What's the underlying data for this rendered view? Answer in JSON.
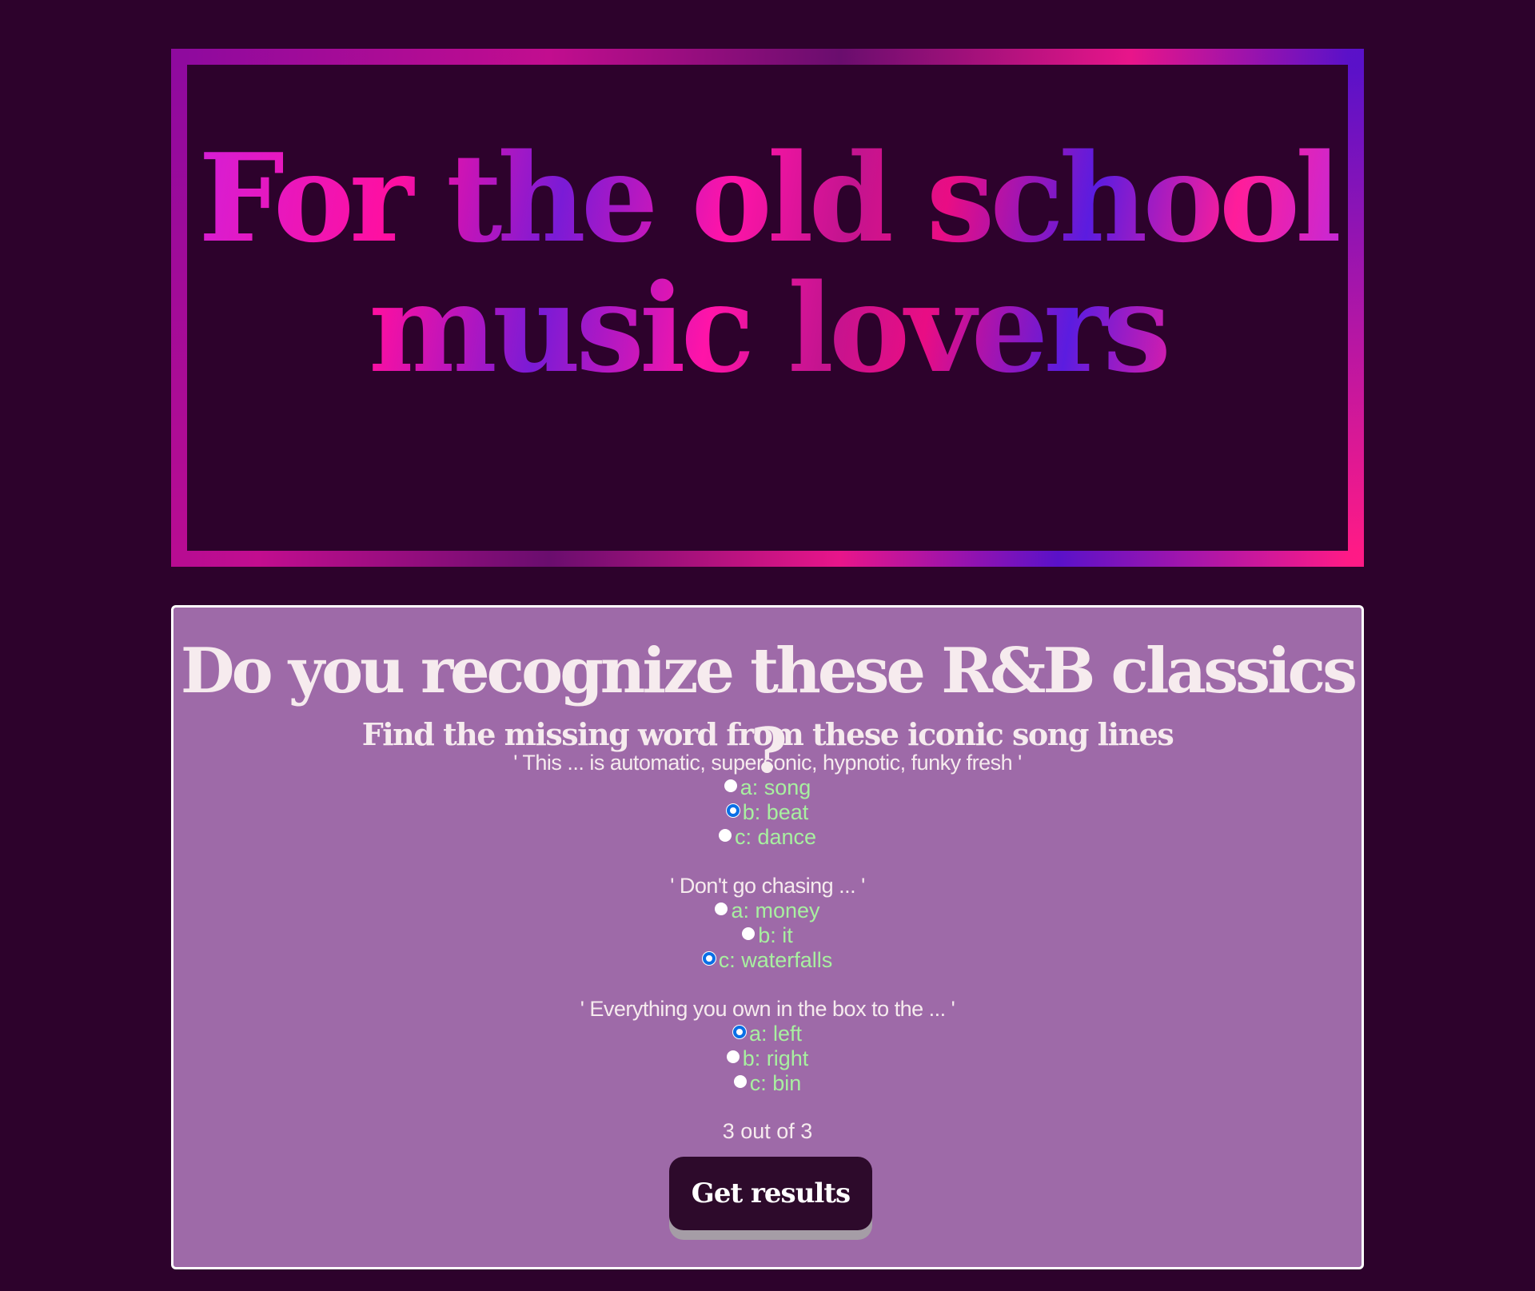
{
  "hero": {
    "title": "For the old school music lovers"
  },
  "quiz": {
    "title": "Do you recognize these R&B classics ?",
    "subtitle": "Find the missing word from these iconic song lines",
    "questions": [
      {
        "line": "' This ... is automatic, supersonic, hypnotic, funky fresh '",
        "options": [
          {
            "label": "a: song",
            "selected": false
          },
          {
            "label": "b: beat",
            "selected": true
          },
          {
            "label": "c: dance",
            "selected": false
          }
        ]
      },
      {
        "line": "' Don't go chasing ... '",
        "options": [
          {
            "label": "a: money",
            "selected": false
          },
          {
            "label": "b: it",
            "selected": false
          },
          {
            "label": "c: waterfalls",
            "selected": true
          }
        ]
      },
      {
        "line": "' Everything you own in the box to the ... '",
        "options": [
          {
            "label": "a: left",
            "selected": true
          },
          {
            "label": "b: right",
            "selected": false
          },
          {
            "label": "c: bin",
            "selected": false
          }
        ]
      }
    ],
    "progress": "3 out of 3",
    "submit_label": "Get results"
  },
  "colors": {
    "background": "#2d022c",
    "card": "#9e6aa8",
    "option_text": "#a8f0a0",
    "button": "#2d0a2b",
    "radio_selected": "#0a6fe6"
  }
}
